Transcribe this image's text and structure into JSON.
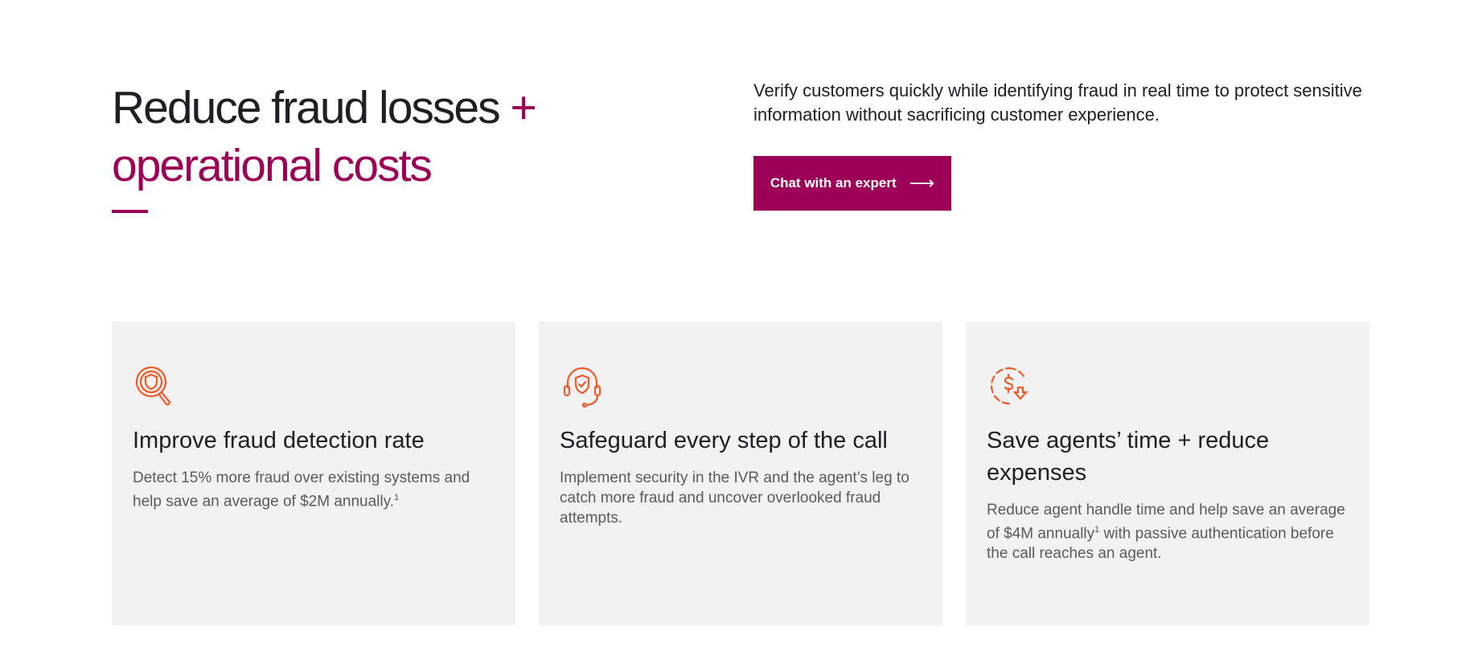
{
  "hero": {
    "title_line1": "Reduce fraud losses",
    "title_plus": "+",
    "title_line2": "operational costs",
    "intro": "Verify customers quickly while identifying fraud in real time to protect sensitive information without sacrificing customer experience.",
    "cta_label": "Chat with an expert",
    "cta_icon": "arrow-right-icon"
  },
  "colors": {
    "brand": "#9c0057",
    "icon": "#f05a28",
    "card_bg": "#f2f2f2"
  },
  "cards": [
    {
      "icon": "magnifier-shield-icon",
      "title": "Improve fraud detection rate",
      "body": "Detect 15% more fraud over existing systems and help save an average of $2M annually.",
      "footnote": "1",
      "body_after": ""
    },
    {
      "icon": "headset-shield-icon",
      "title": "Safeguard every step of the call",
      "body": "Implement security in the IVR and the agent’s leg to catch more fraud and uncover overlooked fraud attempts.",
      "footnote": "",
      "body_after": ""
    },
    {
      "icon": "dollar-down-icon",
      "title": "Save agents’ time + reduce expenses",
      "body": "Reduce agent handle time and help save an average of $4M annually",
      "footnote": "1",
      "body_after": " with passive authentication before the call reaches an agent."
    }
  ]
}
